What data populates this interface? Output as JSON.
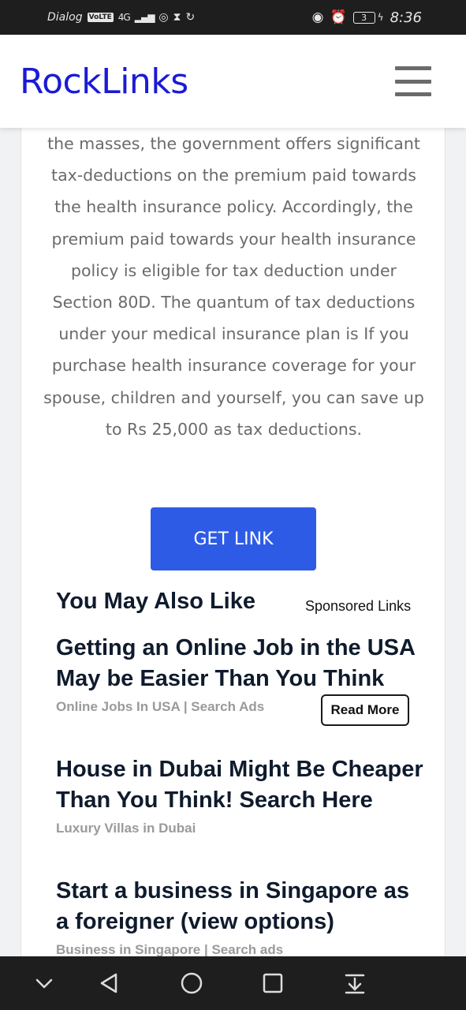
{
  "status_bar": {
    "carrier": "Dialog",
    "volte": "VoLTE",
    "network": "4G",
    "battery": "3",
    "time": "8:36"
  },
  "header": {
    "brand": "RockLinks",
    "menu_icon": "hamburger-menu-icon"
  },
  "content": {
    "paragraph": "the masses, the government offers significant tax-deductions on the premium paid towards the health insurance policy. Accordingly, the premium paid towards your health insurance policy is eligible for tax deduction under Section 80D. The quantum of tax deductions under your medical insurance plan is If you purchase health insurance coverage for your spouse, children and yourself, you can save up to Rs 25,000 as tax deductions.",
    "get_link_label": "GET LINK"
  },
  "recommendations": {
    "title": "You May Also Like",
    "sponsored_label": "Sponsored Links",
    "read_more_label": "Read More",
    "articles": [
      {
        "title": "Getting an Online Job in the USA May be Easier Than You Think",
        "source": "Online Jobs In USA | Search Ads"
      },
      {
        "title": "House in Dubai Might Be Cheaper Than You Think! Search Here",
        "source": "Luxury Villas in Dubai"
      },
      {
        "title": "Start a business in Singapore as a foreigner (view options)",
        "source": "Business in Singapore | Search ads"
      }
    ]
  },
  "nav_bar": {
    "icons": [
      "chevron-down-icon",
      "back-icon",
      "home-icon",
      "recents-icon",
      "notification-pull-icon"
    ]
  },
  "colors": {
    "brand": "#1a1ad6",
    "button": "#2e5be6",
    "heading": "#0f1b2d",
    "muted": "#9a9a9a"
  }
}
